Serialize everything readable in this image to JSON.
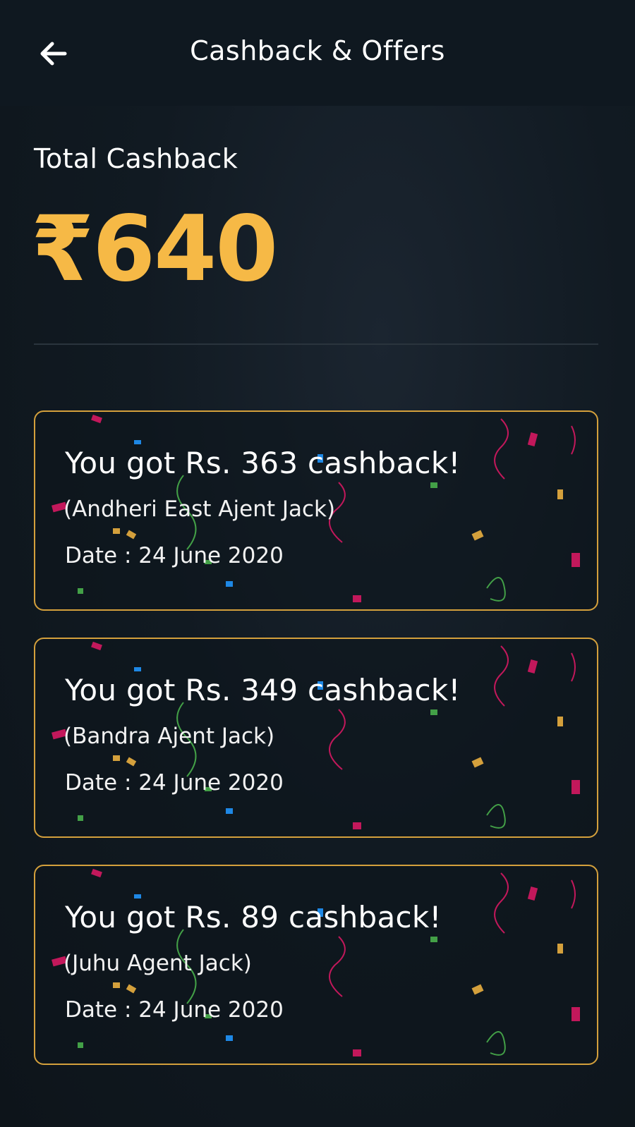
{
  "header": {
    "back_icon": "arrow-left-icon",
    "title": "Cashback & Offers"
  },
  "summary": {
    "label": "Total Cashback",
    "amount": "₹640"
  },
  "cashbacks": [
    {
      "title": "You got Rs. 363 cashback!",
      "location": "(Andheri East Ajent Jack)",
      "date": "Date : 24 June 2020"
    },
    {
      "title": "You got Rs. 349 cashback!",
      "location": "(Bandra Ajent Jack)",
      "date": "Date : 24 June 2020"
    },
    {
      "title": "You got Rs. 89 cashback!",
      "location": "(Juhu Agent Jack)",
      "date": "Date : 24 June 2020"
    }
  ],
  "colors": {
    "accent": "#f6b946",
    "card_border": "#d4a03c",
    "background": "#111a22"
  }
}
